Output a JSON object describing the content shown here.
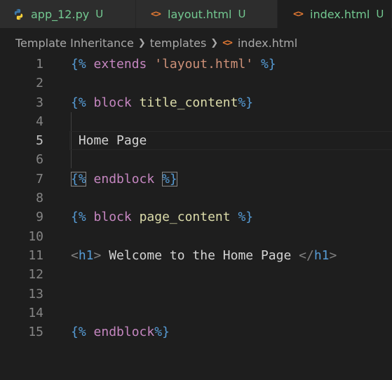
{
  "tabs": [
    {
      "label": "app_12.py",
      "status": "U",
      "icon": "python-icon",
      "active": false
    },
    {
      "label": "layout.html",
      "status": "U",
      "icon": "html-icon",
      "active": false
    },
    {
      "label": "index.html",
      "status": "U",
      "icon": "html-icon",
      "active": true
    }
  ],
  "breadcrumbs": {
    "folder": "Template Inheritance",
    "subfolder": "templates",
    "file": "index.html"
  },
  "code": {
    "current_line": 5,
    "lines": [
      {
        "n": "1",
        "tokens": [
          [
            "delim",
            "{%"
          ],
          [
            "text",
            " "
          ],
          [
            "kw",
            "extends"
          ],
          [
            "text",
            " "
          ],
          [
            "str",
            "'layout.html'"
          ],
          [
            "text",
            " "
          ],
          [
            "delim",
            "%}"
          ]
        ]
      },
      {
        "n": "2",
        "tokens": []
      },
      {
        "n": "3",
        "tokens": [
          [
            "delim",
            "{%"
          ],
          [
            "text",
            " "
          ],
          [
            "kw",
            "block"
          ],
          [
            "text",
            " "
          ],
          [
            "name",
            "title_content"
          ],
          [
            "delim",
            "%}"
          ]
        ]
      },
      {
        "n": "4",
        "tokens": []
      },
      {
        "n": "5",
        "tokens": [
          [
            "text",
            " Home Page"
          ]
        ]
      },
      {
        "n": "6",
        "tokens": []
      },
      {
        "n": "7",
        "tokens": [
          [
            "delim-boxed",
            "{%"
          ],
          [
            "text",
            " "
          ],
          [
            "kw",
            "endblock"
          ],
          [
            "text",
            " "
          ],
          [
            "delim-boxed",
            "%}"
          ]
        ]
      },
      {
        "n": "8",
        "tokens": []
      },
      {
        "n": "9",
        "tokens": [
          [
            "delim",
            "{%"
          ],
          [
            "text",
            " "
          ],
          [
            "kw",
            "block"
          ],
          [
            "text",
            " "
          ],
          [
            "name",
            "page_content"
          ],
          [
            "text",
            " "
          ],
          [
            "delim",
            "%}"
          ]
        ]
      },
      {
        "n": "10",
        "tokens": []
      },
      {
        "n": "11",
        "tokens": [
          [
            "tagbr",
            "<"
          ],
          [
            "tag",
            "h1"
          ],
          [
            "tagbr",
            ">"
          ],
          [
            "text",
            " Welcome to the Home Page "
          ],
          [
            "tagbr",
            "</"
          ],
          [
            "tag",
            "h1"
          ],
          [
            "tagbr",
            ">"
          ]
        ]
      },
      {
        "n": "12",
        "tokens": []
      },
      {
        "n": "13",
        "tokens": []
      },
      {
        "n": "14",
        "tokens": []
      },
      {
        "n": "15",
        "tokens": [
          [
            "delim",
            "{%"
          ],
          [
            "text",
            " "
          ],
          [
            "kw",
            "endblock"
          ],
          [
            "delim",
            "%}"
          ]
        ]
      }
    ]
  },
  "colors": {
    "background": "#1e1e1e",
    "tab_bar": "#252526",
    "untracked_green": "#73c991",
    "html_icon_orange": "#e37933",
    "jinja_delimiter": "#569cd6",
    "keyword": "#c586c0",
    "string": "#ce9178",
    "identifier": "#dcdcaa"
  }
}
